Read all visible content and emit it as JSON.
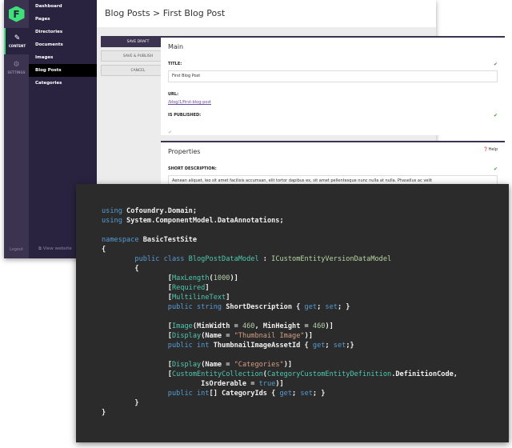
{
  "app": {
    "rail": [
      {
        "label": "CONTENT",
        "icon": "pencil-icon",
        "active": true
      },
      {
        "label": "SETTINGS",
        "icon": "gear-icon",
        "active": false
      }
    ],
    "logout": "Logout",
    "nav": [
      "Dashboard",
      "Pages",
      "Directories",
      "Documents",
      "Images",
      "Blog Posts",
      "Categories"
    ],
    "nav_active": "Blog Posts",
    "view_website": "View website",
    "breadcrumb": "Blog Posts > First Blog Post",
    "actions": {
      "save_draft": "SAVE DRAFT",
      "save_publish": "SAVE & PUBLISH",
      "cancel": "CANCEL"
    },
    "main": {
      "title": "Main",
      "title_label": "TITLE:",
      "title_value": "First Blog Post",
      "url_label": "URL:",
      "url_value": "/blog/1/first-blog-post",
      "published_label": "IS PUBLISHED:"
    },
    "properties": {
      "title": "Properties",
      "help": "Help",
      "short_desc_label": "SHORT DESCRIPTION:",
      "short_desc_value": "Aenean aliquet, leo sit amet facilisis accumsan, elit tortor dapibus ex, sit amet pellentesque nunc nulla at nulla. Phasellus ac velit"
    },
    "colors": {
      "accent": "#3ee07a",
      "sidebar": "#2a2340",
      "primary": "#3b3350"
    }
  },
  "code": [
    [
      [
        "using ",
        "k"
      ],
      [
        "Cofoundry.Domain;",
        "p"
      ]
    ],
    [
      [
        "using ",
        "k"
      ],
      [
        "System.ComponentModel.DataAnnotations;",
        "p"
      ]
    ],
    [],
    [
      [
        "namespace ",
        "k"
      ],
      [
        "BasicTestSite",
        "p"
      ]
    ],
    [
      [
        "{",
        "p"
      ]
    ],
    [
      [
        "        public class ",
        "k"
      ],
      [
        "BlogPostDataModel",
        "t"
      ],
      [
        " : ",
        "p"
      ],
      [
        "ICustomEntityVersionDataModel",
        "i"
      ]
    ],
    [
      [
        "        {",
        "p"
      ]
    ],
    [
      [
        "                [",
        "p"
      ],
      [
        "MaxLength",
        "t"
      ],
      [
        "(",
        "p"
      ],
      [
        "1000",
        "n"
      ],
      [
        ")]",
        "p"
      ]
    ],
    [
      [
        "                [",
        "p"
      ],
      [
        "Required",
        "t"
      ],
      [
        "]",
        "p"
      ]
    ],
    [
      [
        "                [",
        "p"
      ],
      [
        "MultilineText",
        "t"
      ],
      [
        "]",
        "p"
      ]
    ],
    [
      [
        "                public string ",
        "k"
      ],
      [
        "ShortDescription { ",
        "p"
      ],
      [
        "get",
        "k"
      ],
      [
        "; ",
        "p"
      ],
      [
        "set",
        "k"
      ],
      [
        "; }",
        "p"
      ]
    ],
    [],
    [
      [
        "                [",
        "p"
      ],
      [
        "Image",
        "t"
      ],
      [
        "(MinWidth = ",
        "p"
      ],
      [
        "460",
        "n"
      ],
      [
        ", MinHeight = ",
        "p"
      ],
      [
        "460",
        "n"
      ],
      [
        ")]",
        "p"
      ]
    ],
    [
      [
        "                [",
        "p"
      ],
      [
        "Display",
        "t"
      ],
      [
        "(Name = ",
        "p"
      ],
      [
        "\"Thumbnail Image\"",
        "s"
      ],
      [
        ")]",
        "p"
      ]
    ],
    [
      [
        "                public int ",
        "k"
      ],
      [
        "ThumbnailImageAssetId { ",
        "p"
      ],
      [
        "get",
        "k"
      ],
      [
        "; ",
        "p"
      ],
      [
        "set",
        "k"
      ],
      [
        ";}",
        "p"
      ]
    ],
    [],
    [
      [
        "                [",
        "p"
      ],
      [
        "Display",
        "t"
      ],
      [
        "(Name = ",
        "p"
      ],
      [
        "\"Categories\"",
        "s"
      ],
      [
        ")]",
        "p"
      ]
    ],
    [
      [
        "                [",
        "p"
      ],
      [
        "CustomEntityCollection",
        "t"
      ],
      [
        "(",
        "p"
      ],
      [
        "CategoryCustomEntityDefinition",
        "t"
      ],
      [
        ".DefinitionCode,",
        "p"
      ]
    ],
    [
      [
        "                        IsOrderable = ",
        "p"
      ],
      [
        "true",
        "k"
      ],
      [
        ")]",
        "p"
      ]
    ],
    [
      [
        "                public int",
        "k"
      ],
      [
        "[] CategoryIds { ",
        "p"
      ],
      [
        "get",
        "k"
      ],
      [
        "; ",
        "p"
      ],
      [
        "set",
        "k"
      ],
      [
        "; }",
        "p"
      ]
    ],
    [
      [
        "        }",
        "p"
      ]
    ],
    [
      [
        "}",
        "p"
      ]
    ]
  ]
}
